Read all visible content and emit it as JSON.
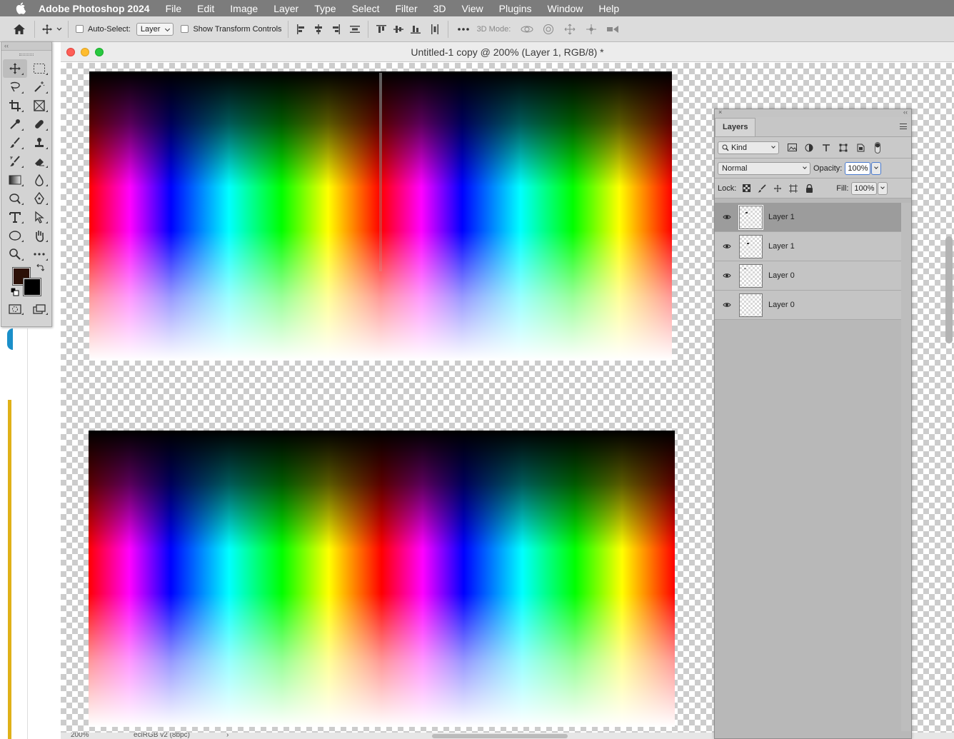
{
  "menubar": {
    "app_name": "Adobe Photoshop 2024",
    "items": [
      "File",
      "Edit",
      "Image",
      "Layer",
      "Type",
      "Select",
      "Filter",
      "3D",
      "View",
      "Plugins",
      "Window",
      "Help"
    ]
  },
  "options_bar": {
    "auto_select_label": "Auto-Select:",
    "auto_select_value": "Layer",
    "show_transform_label": "Show Transform Controls",
    "mode_3d_label": "3D Mode:"
  },
  "toolbar": {
    "collapse_label": "‹‹",
    "foreground_color": "#2b1006",
    "background_color": "#000000"
  },
  "document": {
    "title": "Untitled-1 copy @ 200% (Layer 1, RGB/8) *",
    "zoom": "200%",
    "profile": "eciRGB v2 (8bpc)",
    "status_arrow": "›"
  },
  "layers_panel": {
    "close_label": "×",
    "collapse_label": "‹‹",
    "tab_label": "Layers",
    "filter_kind": "Kind",
    "blend_mode": "Normal",
    "opacity_label": "Opacity:",
    "opacity_value": "100%",
    "lock_label": "Lock:",
    "fill_label": "Fill:",
    "fill_value": "100%",
    "layers": [
      {
        "name": "Layer 1",
        "selected": true
      },
      {
        "name": "Layer 1",
        "selected": false
      },
      {
        "name": "Layer 0",
        "selected": false
      },
      {
        "name": "Layer 0",
        "selected": false
      }
    ]
  }
}
